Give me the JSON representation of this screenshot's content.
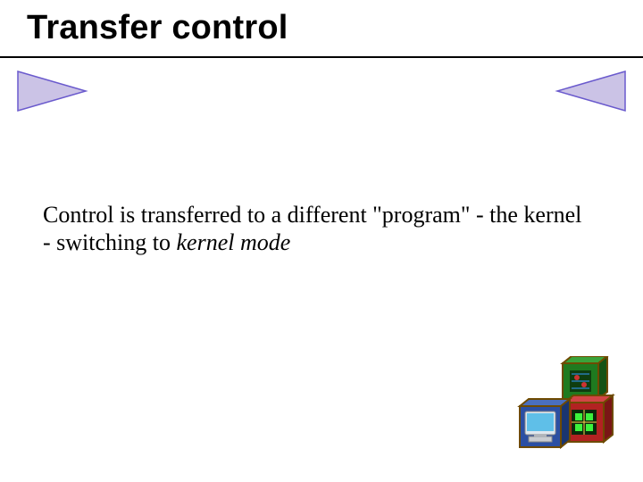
{
  "slide": {
    "title": "Transfer control",
    "body_prefix": "Control is transferred to a different \"program\" - the kernel - switching to ",
    "body_italic": "kernel mode"
  },
  "nav": {
    "prev_name": "prev-arrow-icon",
    "next_name": "next-arrow-icon"
  },
  "icons": {
    "decor": "blocks-icon"
  },
  "colors": {
    "arrow_fill": "#cbc3e6",
    "arrow_stroke": "#6a5acd",
    "block_red": "#b22222",
    "block_green": "#1f7a1f",
    "block_blue": "#2b4fa3",
    "block_edge": "#6e4a00"
  }
}
